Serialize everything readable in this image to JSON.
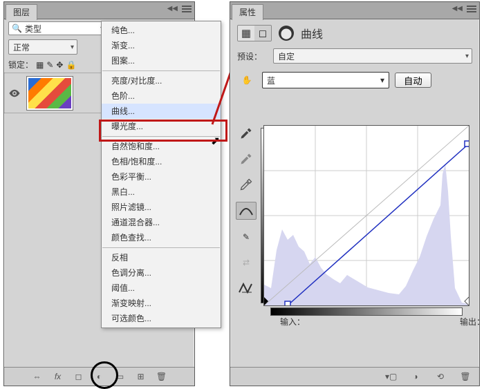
{
  "layers_panel": {
    "title": "图层",
    "search_label": "类型",
    "blend_mode": "正常",
    "lock_label": "锁定：",
    "bottom_icons": [
      "⇔",
      "fx",
      "◻",
      "◐",
      "▭",
      "⊞",
      "🗑"
    ]
  },
  "adjustment_menu": {
    "items": [
      "纯色...",
      "渐变...",
      "图案...",
      "__sep__",
      "亮度/对比度...",
      "色阶...",
      "曲线...",
      "曝光度...",
      "__sep__",
      "自然饱和度...",
      "色相/饱和度...",
      "色彩平衡...",
      "黑白...",
      "照片滤镜...",
      "通道混合器...",
      "颜色查找...",
      "__sep__",
      "反相",
      "色调分离...",
      "阈值...",
      "渐变映射...",
      "可选颜色..."
    ],
    "highlighted": "曲线..."
  },
  "properties_panel": {
    "tab": "属性",
    "title": "曲线",
    "preset_label": "预设：",
    "preset_value": "自定",
    "channel_value": "蓝",
    "auto_label": "自动",
    "input_label": "输入：",
    "output_label": "输出：",
    "bottom_icons": [
      "⟲",
      "◐",
      "◉",
      "🗑"
    ]
  },
  "chart_data": {
    "type": "line",
    "title": "曲线",
    "xlabel": "输入",
    "ylabel": "输出",
    "xlim": [
      0,
      255
    ],
    "ylim": [
      0,
      255
    ],
    "series": [
      {
        "name": "蓝",
        "points": [
          {
            "in": 30,
            "out": 0
          },
          {
            "in": 255,
            "out": 230
          }
        ]
      }
    ],
    "histogram_channel": "蓝"
  }
}
